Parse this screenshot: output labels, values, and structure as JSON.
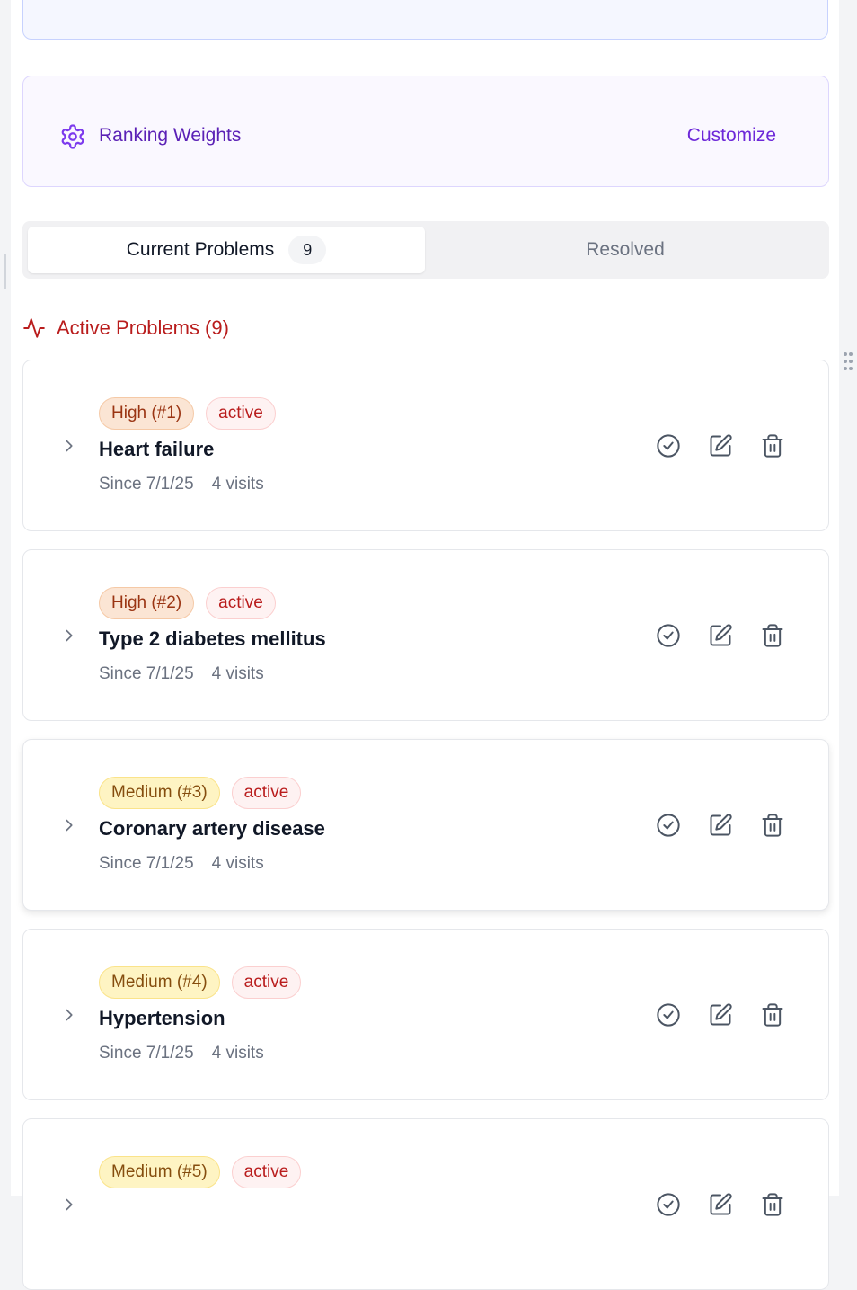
{
  "weights": {
    "title": "Ranking Weights",
    "customize_label": "Customize"
  },
  "tabs": {
    "current_label": "Current Problems",
    "current_count": "9",
    "resolved_label": "Resolved"
  },
  "section": {
    "heading": "Active Problems (9)"
  },
  "colors": {
    "accent_purple": "#6d28d9",
    "active_red": "#b91c1c",
    "high_bg": "#fbe5d4",
    "medium_bg": "#fef4c3"
  },
  "problems": [
    {
      "priority": "High (#1)",
      "level": "high",
      "status": "active",
      "name": "Heart failure",
      "since": "Since 7/1/25",
      "visits": "4 visits"
    },
    {
      "priority": "High (#2)",
      "level": "high",
      "status": "active",
      "name": "Type 2 diabetes mellitus",
      "since": "Since 7/1/25",
      "visits": "4 visits"
    },
    {
      "priority": "Medium (#3)",
      "level": "medium",
      "status": "active",
      "name": "Coronary artery disease",
      "since": "Since 7/1/25",
      "visits": "4 visits"
    },
    {
      "priority": "Medium (#4)",
      "level": "medium",
      "status": "active",
      "name": "Hypertension",
      "since": "Since 7/1/25",
      "visits": "4 visits"
    },
    {
      "priority": "Medium (#5)",
      "level": "medium",
      "status": "active"
    }
  ]
}
